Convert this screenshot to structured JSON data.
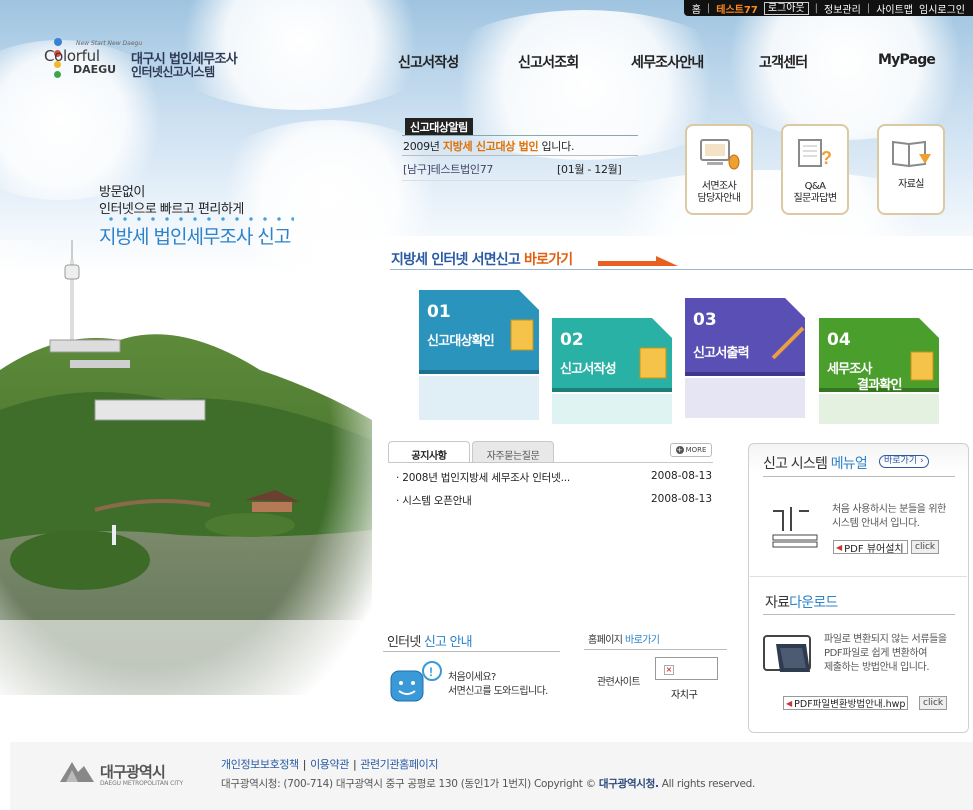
{
  "topbar": {
    "home": "홈",
    "user": "테스트77",
    "logout": "로그아웃",
    "info": "정보관리",
    "sitemap": "사이트맵",
    "temp_login": "임시로그인"
  },
  "logo": {
    "tagline": "New Start New Daegu",
    "colorful": "Colorful",
    "daegu": "DAEGU",
    "title_line1": "대구시 법인세무조사",
    "title_line2": "인터넷신고시스템"
  },
  "nav": {
    "items": [
      "신고서작성",
      "신고서조회",
      "세무조사안내",
      "고객센터",
      "MyPage"
    ]
  },
  "slogan": {
    "line1": "방문없이",
    "line2": "인터넷으로 빠르고 편리하게",
    "line3": "지방세 법인세무조사 신고"
  },
  "alarm": {
    "tag": "신고대상알림",
    "year": "2009년",
    "highlight": "지방세 신고대상 법인",
    "suffix": "입니다.",
    "company": "[남구]테스트법인77",
    "period": "[01월 - 12월]"
  },
  "quick": {
    "items": [
      {
        "label1": "서면조사",
        "label2": "담당자안내"
      },
      {
        "label1": "Q&A",
        "label2": "질문과답변"
      },
      {
        "label1": "자료실",
        "label2": ""
      }
    ]
  },
  "online": {
    "title": "지방세 인터넷 서면신고",
    "go": "바로가기"
  },
  "steps": {
    "items": [
      {
        "num": "01",
        "label1": "신고대상확인",
        "label2": "",
        "color": "#2a94bd"
      },
      {
        "num": "02",
        "label1": "신고서작성",
        "label2": "",
        "color": "#29b1a6"
      },
      {
        "num": "03",
        "label1": "신고서출력",
        "label2": "",
        "color": "#5a4fb5"
      },
      {
        "num": "04",
        "label1": "세무조사",
        "label2": "결과확인",
        "color": "#4a9e2c"
      }
    ]
  },
  "board": {
    "tabs": [
      "공지사항",
      "자주묻는질문"
    ],
    "more": "MORE",
    "rows": [
      {
        "title": "2008년 법인지방세 세무조사 인터넷...",
        "date": "2008-08-13"
      },
      {
        "title": "시스템 오픈안내",
        "date": "2008-08-13"
      }
    ]
  },
  "manual": {
    "title_plain": "신고 시스템",
    "title_blue": "메뉴얼",
    "link": "바로가기",
    "text1": "처음 사용하시는 분들을 위한",
    "text2": "시스템 안내서 입니다.",
    "button": "PDF 뷰어설치",
    "click": "click"
  },
  "download": {
    "title_plain": "자료",
    "title_blue": "다운로드",
    "text1": "파일로 변환되지 않는 서류들을",
    "text2": "PDF파일로 쉽게 변환하여",
    "text3": "제출하는 방법안내 입니다.",
    "button": "PDF파일변환방법안내.hwp",
    "click": "click"
  },
  "guide": {
    "title_plain": "인터넷",
    "title_blue": "신고 안내",
    "text1": "처음이세요?",
    "text2": "서면신고를 도와드립니다."
  },
  "homepage": {
    "title_plain": "홈페이지",
    "title_blue": "바로가기",
    "label": "관련사이트",
    "selected": "자치구"
  },
  "footer": {
    "logo": "대구광역시",
    "logo_sub": "DAEGU METROPOLITAN CITY",
    "links": [
      "개인정보보호정책",
      "이용약관",
      "관련기관홈페이지"
    ],
    "address": "대구광역시청: (700-714) 대구광역시 중구 공평로 130  (동인1가 1번지) Copyright ©",
    "owner": "대구광역시청.",
    "rights": "All rights reserved."
  }
}
